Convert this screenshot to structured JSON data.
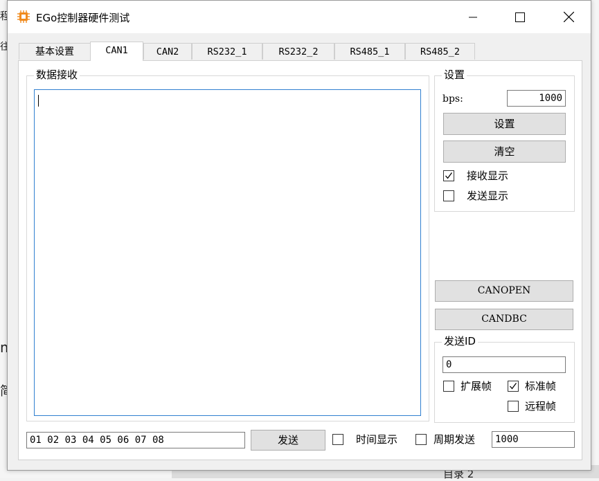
{
  "window": {
    "title": "EGo控制器硬件测试"
  },
  "tabs": [
    {
      "label": "基本设置"
    },
    {
      "label": "CAN1"
    },
    {
      "label": "CAN2"
    },
    {
      "label": "RS232_1"
    },
    {
      "label": "RS232_2"
    },
    {
      "label": "RS485_1"
    },
    {
      "label": "RS485_2"
    }
  ],
  "receive": {
    "group_label": "数据接收",
    "content": ""
  },
  "settings": {
    "group_label": "设置",
    "bps_label": "bps:",
    "bps_value": "1000",
    "set_button": "设置",
    "clear_button": "清空",
    "show_receive_label": "接收显示",
    "show_receive_checked": true,
    "show_send_label": "发送显示",
    "show_send_checked": false
  },
  "tools": {
    "canopen_button": "CANOPEN",
    "candbc_button": "CANDBC"
  },
  "send_id": {
    "group_label": "发送ID",
    "value": "0",
    "extended_label": "扩展帧",
    "extended_checked": false,
    "standard_label": "标准帧",
    "standard_checked": true,
    "remote_label": "远程帧",
    "remote_checked": false
  },
  "bottom": {
    "send_data": "01 02 03 04 05 06 07 08",
    "send_button": "发送",
    "show_time_label": "时间显示",
    "show_time_checked": false,
    "periodic_label": "周期发送",
    "periodic_checked": false,
    "period_value": "1000"
  },
  "background": {
    "frag1": "程",
    "frag2": "往",
    "frag3": "m",
    "frag4": "简",
    "doc_text": "目录 2"
  }
}
